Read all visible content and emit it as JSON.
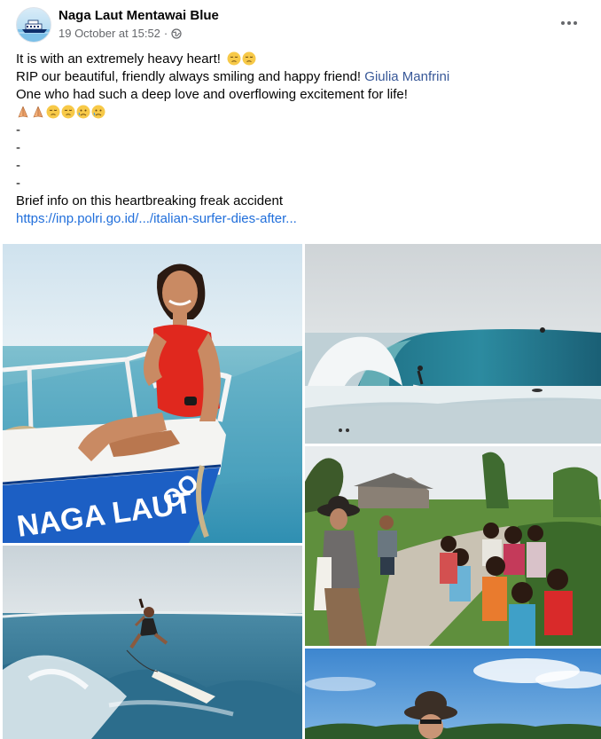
{
  "post": {
    "page_name": "Naga Laut Mentawai Blue",
    "timestamp": "19 October at 15:52",
    "separator": "·",
    "audience_icon": "globe-icon",
    "more_icon": "more-horizontal-icon"
  },
  "message": {
    "line1": "It is with an extremely heavy heart!",
    "line1_emojis": [
      "pensive-face-emoji",
      "pensive-face-emoji"
    ],
    "line2_prefix": "RIP our beautiful, friendly always smiling and happy friend!",
    "mention": "Giulia Manfrini",
    "line3": "One who had such a deep love and overflowing excitement for life!",
    "line4_emojis": [
      "folded-hands-emoji",
      "folded-hands-emoji",
      "pensive-face-emoji",
      "pensive-face-emoji",
      "sad-relieved-face-emoji",
      "sad-relieved-face-emoji"
    ],
    "dashes": [
      "-",
      "-",
      "-",
      "-",
      "-"
    ],
    "info_line": "Brief info on this heartbreaking freak accident",
    "link": "https://inp.polri.go.id/.../italian-surfer-dies-after..."
  },
  "photos": {
    "boat_text": "NAGA LAUT",
    "boat_text_tail": "OO"
  },
  "colors": {
    "link": "#385898",
    "url": "#216fdb",
    "secondary_text": "#65676b",
    "boat_blue": "#1c5fc4"
  }
}
